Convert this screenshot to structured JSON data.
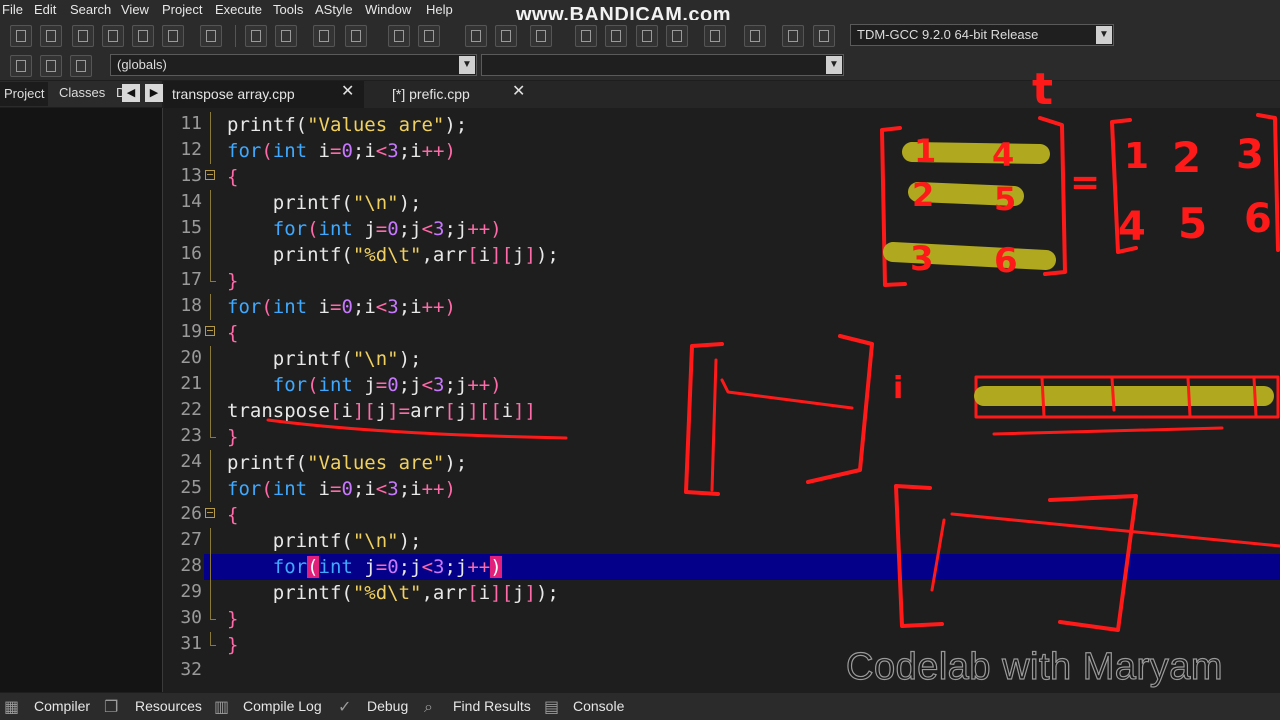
{
  "menu": [
    "File",
    "Edit",
    "Search",
    "View",
    "Project",
    "Execute",
    "Tools",
    "AStyle",
    "Window",
    "Help"
  ],
  "watermark": "www.BANDICAM.com",
  "compiler_select": "TDM-GCC 9.2.0 64-bit Release",
  "scope_select": "(globals)",
  "panel_tabs": [
    "Project",
    "Classes",
    "D"
  ],
  "editor_tabs": [
    {
      "label": "transpose array.cpp"
    },
    {
      "label": "[*] prefic.cpp"
    }
  ],
  "lines": [
    {
      "n": "11"
    },
    {
      "n": "12"
    },
    {
      "n": "13"
    },
    {
      "n": "14"
    },
    {
      "n": "15"
    },
    {
      "n": "16"
    },
    {
      "n": "17"
    },
    {
      "n": "18"
    },
    {
      "n": "19"
    },
    {
      "n": "20"
    },
    {
      "n": "21"
    },
    {
      "n": "22"
    },
    {
      "n": "23"
    },
    {
      "n": "24"
    },
    {
      "n": "25"
    },
    {
      "n": "26"
    },
    {
      "n": "27"
    },
    {
      "n": "28"
    },
    {
      "n": "29"
    },
    {
      "n": "30"
    },
    {
      "n": "31"
    },
    {
      "n": "32"
    }
  ],
  "bottom_tabs": [
    "Compiler",
    "Resources",
    "Compile Log",
    "Debug",
    "Find Results",
    "Console"
  ],
  "credit": "Codelab with Maryam",
  "annotations": {
    "t_label": "t",
    "i_label": "i",
    "left_matrix": [
      [
        "1",
        "4"
      ],
      [
        "2",
        "5"
      ],
      [
        "3",
        "6"
      ]
    ],
    "equals": "=",
    "right_matrix": [
      [
        "1",
        "2",
        "3"
      ],
      [
        "4",
        "5",
        "6"
      ]
    ]
  },
  "colors": {
    "highlight": "#05008a",
    "ink": "#ff1a1a",
    "marker": "#b8b020",
    "keyword": "#3fa9ff",
    "string": "#f0d060",
    "number": "#c778ff"
  }
}
